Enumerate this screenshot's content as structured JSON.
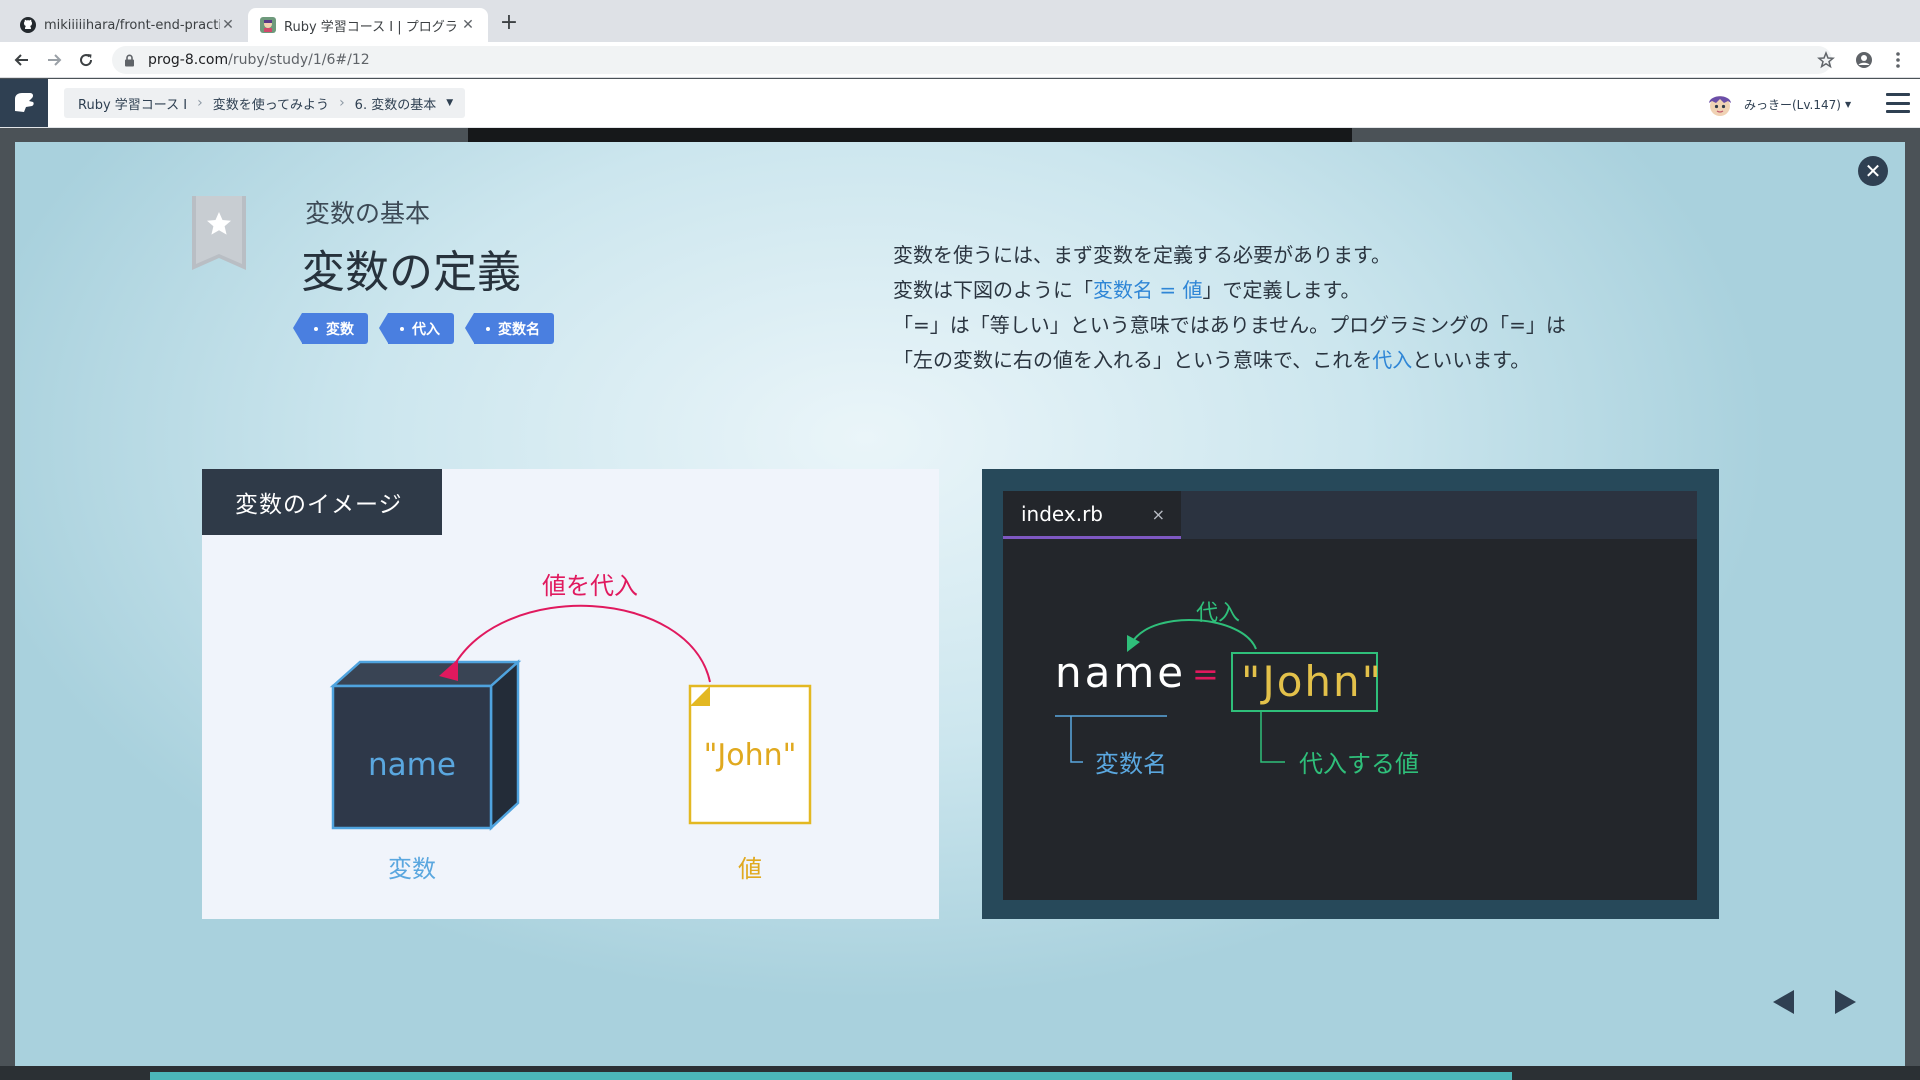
{
  "browser": {
    "tabs": [
      {
        "title": "mikiiiiihara/front-end-practice",
        "icon": "github-icon",
        "active": false
      },
      {
        "title": "Ruby 学習コース I | プログラミン",
        "icon": "prog8-favicon",
        "active": true
      }
    ],
    "url_host": "prog-8.com",
    "url_path": "/ruby/study/1/6#/12"
  },
  "header": {
    "breadcrumb": [
      "Ruby 学習コース Ⅰ",
      "変数を使ってみよう",
      "6. 変数の基本"
    ],
    "user_label": "みっきー(Lv.147)"
  },
  "slide": {
    "subtitle": "変数の基本",
    "title": "変数の定義",
    "tags": [
      "変数",
      "代入",
      "変数名"
    ],
    "description": {
      "line1": "変数を使うには、まず変数を定義する必要があります。",
      "line2_pre": "変数は下図のように「",
      "line2_hl": "変数名 = 値",
      "line2_post": "」で定義します。",
      "line3": "「=」は「等しい」という意味ではありません。プログラミングの「=」は",
      "line4_pre": "「左の変数に右の値を入れる」という意味で、これを",
      "line4_hl": "代入",
      "line4_post": "といいます。"
    },
    "image_panel": {
      "title": "変数のイメージ",
      "arrow_label": "値を代入",
      "box_text": "name",
      "box_caption": "変数",
      "paper_text": "\"John\"",
      "paper_caption": "値"
    },
    "editor": {
      "filename": "index.rb",
      "close_glyph": "×",
      "arrow_label": "代入",
      "var": "name",
      "op": "=",
      "value": "\"John\"",
      "var_caption": "変数名",
      "value_caption": "代入する値"
    }
  },
  "colors": {
    "accent_pink": "#e0195e",
    "var_blue": "#5aa7df",
    "value_yellow": "#e3b822",
    "code_green": "#2fbf7a",
    "tag_blue": "#4a7fe0"
  }
}
